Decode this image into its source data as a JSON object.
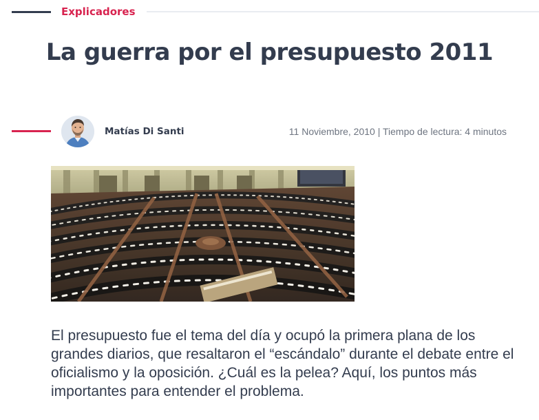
{
  "section": {
    "label": "Explicadores"
  },
  "article": {
    "title": "La guerra por el presupuesto 2011",
    "author": {
      "name": "Matías Di Santi",
      "avatar_icon": "author-avatar"
    },
    "meta": "11 Noviembre, 2010 | Tiempo de lectura: 4 minutos",
    "image": {
      "subject": "chamber-photo"
    },
    "lede": "El presupuesto fue el tema del día y ocupó la primera plana de los grandes diarios, que resaltaron el “escándalo” durante el debate entre el oficialismo y la oposición. ¿Cuál es la pelea? Aquí, los puntos más importantes para entender el problema."
  },
  "colors": {
    "accent": "#d8234f",
    "text": "#333c4e",
    "muted": "#6d7480",
    "rule": "#e9ecf1"
  }
}
